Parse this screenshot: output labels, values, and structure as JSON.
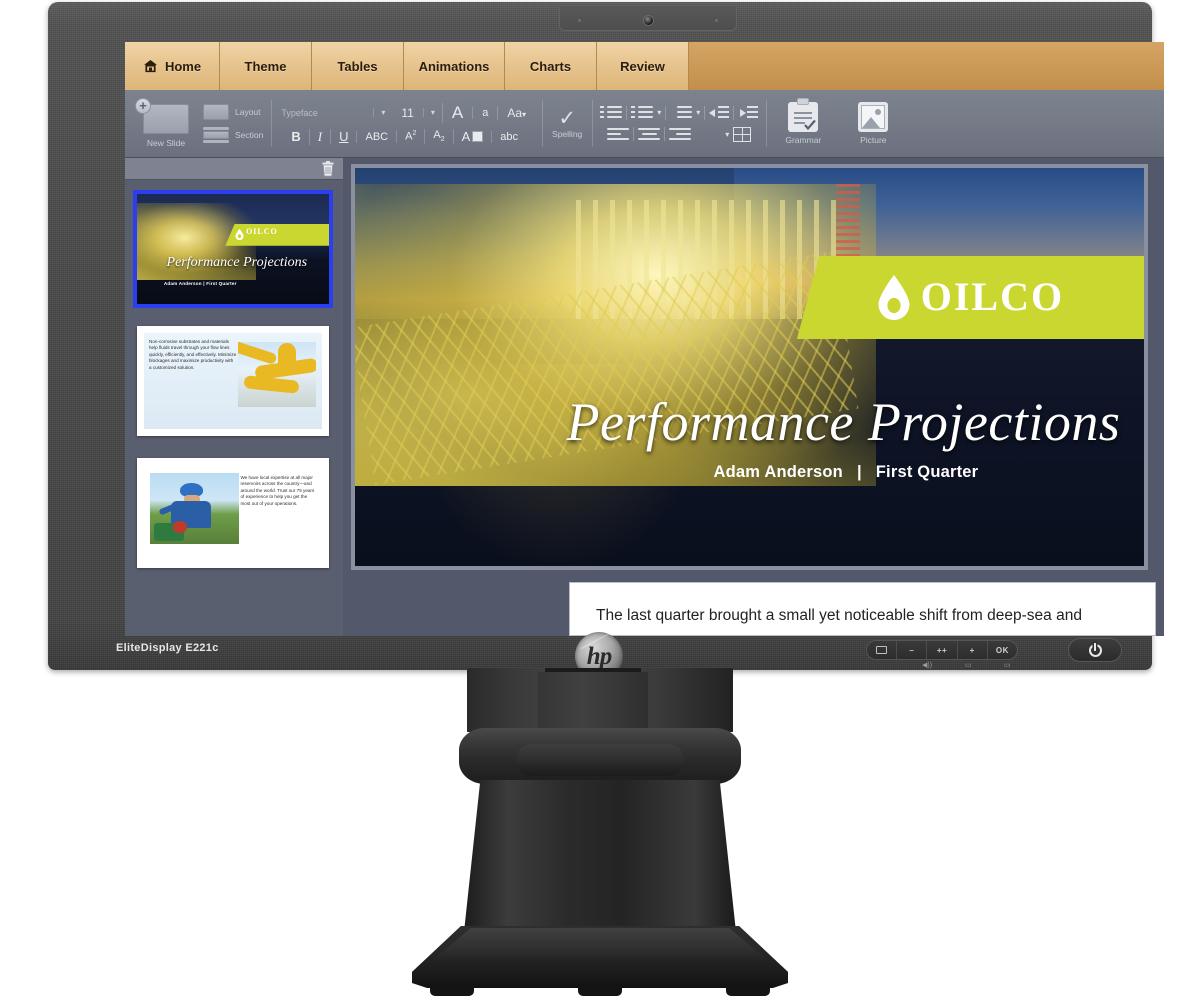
{
  "monitor": {
    "brand_label": "EliteDisplay E221c",
    "vendor_logo": "hp",
    "webcam_icon": "webcam-icon",
    "osd": {
      "menu_icon": "menu-icon",
      "minus_label": "–",
      "plusplus_label": "++",
      "plus_label": "+",
      "ok_label": "OK",
      "sub_volume_icon": "speaker-icon",
      "sub_input_icon": "input-source-icon",
      "sub_display_icon": "display-icon",
      "power_icon": "power-icon"
    }
  },
  "app": {
    "tabs": [
      {
        "label": "Home",
        "icon": "home-icon",
        "active": true
      },
      {
        "label": "Theme",
        "icon": "",
        "active": false
      },
      {
        "label": "Tables",
        "icon": "",
        "active": false
      },
      {
        "label": "Animations",
        "icon": "",
        "active": false
      },
      {
        "label": "Charts",
        "icon": "",
        "active": false
      },
      {
        "label": "Review",
        "icon": "",
        "active": false
      }
    ],
    "ribbon": {
      "new_slide_label": "New Slide",
      "new_slide_icon": "new-slide-icon",
      "layout_label": "Layout",
      "section_label": "Section",
      "typeface_placeholder": "Typeface",
      "font_size_value": "11",
      "grow_font_label": "A",
      "shrink_font_label": "a",
      "change_case_label": "Aa",
      "bold_label": "B",
      "italic_label": "I",
      "underline_label": "U",
      "strikethrough_label": "ABC",
      "superscript_label": "A",
      "superscript_exp": "2",
      "subscript_label": "A",
      "subscript_exp": "2",
      "font_color_label": "A",
      "text_effects_label": "abc",
      "spelling_label": "Spelling",
      "spelling_icon": "checkmark-icon",
      "grammar_label": "Grammar",
      "grammar_icon": "clipboard-check-icon",
      "picture_label": "Picture",
      "picture_icon": "picture-icon",
      "bullets_icon": "bulleted-list-icon",
      "numbering_icon": "numbered-list-icon",
      "line_spacing_icon": "line-spacing-icon",
      "decrease_indent_icon": "decrease-indent-icon",
      "increase_indent_icon": "increase-indent-icon",
      "align_left_icon": "align-left-icon",
      "align_center_icon": "align-center-icon",
      "align_right_icon": "align-right-icon",
      "table_icon": "table-icon",
      "caret_icon": "chevron-down-icon"
    },
    "slide_panel": {
      "delete_icon": "trash-icon",
      "slides": [
        {
          "index": 1,
          "selected": true,
          "type": "title",
          "title": "Performance Projections",
          "subtitle": "Adam Anderson   |   First Quarter",
          "logo_text": "OILCO",
          "logo_icon": "oil-drop-icon"
        },
        {
          "index": 2,
          "selected": false,
          "type": "text-image",
          "body": "Non-corrosive substrates and materials help fluids travel through your flow lines quickly, efficiently, and effectively. Minimize blockages and maximize productivity with a customized solution."
        },
        {
          "index": 3,
          "selected": false,
          "type": "image-text",
          "body": "We have local expertise at all major reservoirs across the country—and around the world. Trust our 75 years of experience to help you get the most out of your operations."
        }
      ]
    },
    "current_slide": {
      "title": "Performance Projections",
      "author": "Adam Anderson",
      "separator": "|",
      "quarter": "First Quarter",
      "logo_text": "OILCO",
      "logo_icon": "oil-drop-icon",
      "background_image": "offshore-oil-rig-at-night"
    },
    "notes": {
      "text": "The last quarter brought a small yet noticeable shift from deep-sea and unconventional oil production wells to inland natural gas plays. This can be attributed to pricing shifts that enhanced"
    }
  },
  "colors": {
    "tab_active": "#ebc78f",
    "tab_bar": "#cf9f5c",
    "ribbon": "#767b88",
    "workspace": "#53586a",
    "brand_green": "#cbd731",
    "selection_blue": "#2b3ef0",
    "notes_background": "#ffffff"
  }
}
